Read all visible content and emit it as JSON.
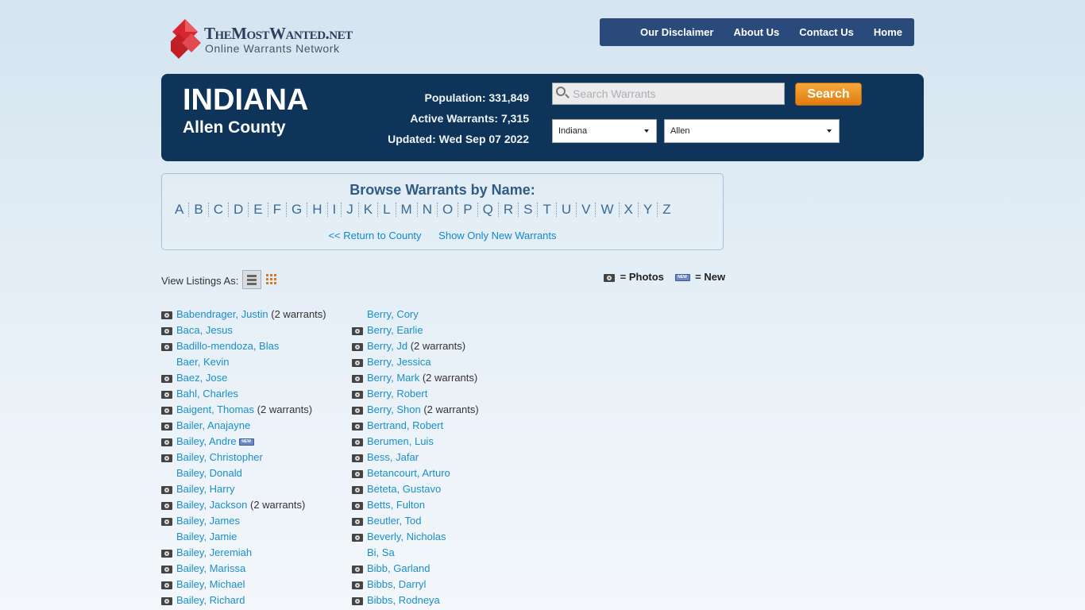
{
  "logo": {
    "title": "TheMostWanted.net",
    "subtitle": "Online Warrants Network"
  },
  "nav": {
    "items": [
      "Our Disclaimer",
      "About Us",
      "Contact Us",
      "Home"
    ]
  },
  "banner": {
    "state": "INDIANA",
    "county": "Allen County",
    "population": "Population: 331,849",
    "active_warrants": "Active Warrants: 7,315",
    "updated": "Updated: Wed Sep 07 2022",
    "search_placeholder": "Search Warrants",
    "search_button": "Search",
    "state_select": "Indiana",
    "county_select": "Allen"
  },
  "browse": {
    "title": "Browse Warrants by Name:",
    "letters": [
      "A",
      "B",
      "C",
      "D",
      "E",
      "F",
      "G",
      "H",
      "I",
      "J",
      "K",
      "L",
      "M",
      "N",
      "O",
      "P",
      "Q",
      "R",
      "S",
      "T",
      "U",
      "V",
      "W",
      "X",
      "Y",
      "Z"
    ],
    "return_link": "<< Return to County",
    "new_link": "Show Only New Warrants"
  },
  "view": {
    "label": "View Listings As:"
  },
  "legend": {
    "photos": "= Photos",
    "new_badge": "NEW",
    "new": "= New"
  },
  "listings": {
    "col1": [
      {
        "name": "Babendrager, Justin",
        "photo": true,
        "count": "(2 warrants)"
      },
      {
        "name": "Baca, Jesus",
        "photo": true,
        "count": ""
      },
      {
        "name": "Badillo-mendoza, Blas",
        "photo": true,
        "count": ""
      },
      {
        "name": "Baer, Kevin",
        "photo": false,
        "count": ""
      },
      {
        "name": "Baez, Jose",
        "photo": true,
        "count": ""
      },
      {
        "name": "Bahl, Charles",
        "photo": true,
        "count": ""
      },
      {
        "name": "Baigent, Thomas",
        "photo": true,
        "count": "(2 warrants)"
      },
      {
        "name": "Bailer, Anajayne",
        "photo": true,
        "count": ""
      },
      {
        "name": "Bailey, Andre",
        "photo": true,
        "count": "",
        "new": true
      },
      {
        "name": "Bailey, Christopher",
        "photo": true,
        "count": ""
      },
      {
        "name": "Bailey, Donald",
        "photo": false,
        "count": ""
      },
      {
        "name": "Bailey, Harry",
        "photo": true,
        "count": ""
      },
      {
        "name": "Bailey, Jackson",
        "photo": true,
        "count": "(2 warrants)"
      },
      {
        "name": "Bailey, James",
        "photo": true,
        "count": ""
      },
      {
        "name": "Bailey, Jamie",
        "photo": false,
        "count": ""
      },
      {
        "name": "Bailey, Jeremiah",
        "photo": true,
        "count": ""
      },
      {
        "name": "Bailey, Marissa",
        "photo": true,
        "count": ""
      },
      {
        "name": "Bailey, Michael",
        "photo": true,
        "count": ""
      },
      {
        "name": "Bailey, Richard",
        "photo": true,
        "count": ""
      }
    ],
    "col2": [
      {
        "name": "Berry, Cory",
        "photo": false,
        "count": ""
      },
      {
        "name": "Berry, Earlie",
        "photo": true,
        "count": ""
      },
      {
        "name": "Berry, Jd",
        "photo": true,
        "count": "(2 warrants)"
      },
      {
        "name": "Berry, Jessica",
        "photo": true,
        "count": ""
      },
      {
        "name": "Berry, Mark",
        "photo": true,
        "count": "(2 warrants)"
      },
      {
        "name": "Berry, Robert",
        "photo": true,
        "count": ""
      },
      {
        "name": "Berry, Shon",
        "photo": true,
        "count": "(2 warrants)"
      },
      {
        "name": "Bertrand, Robert",
        "photo": true,
        "count": ""
      },
      {
        "name": "Berumen, Luis",
        "photo": true,
        "count": ""
      },
      {
        "name": "Bess, Jafar",
        "photo": true,
        "count": ""
      },
      {
        "name": "Betancourt, Arturo",
        "photo": true,
        "count": ""
      },
      {
        "name": "Beteta, Gustavo",
        "photo": true,
        "count": ""
      },
      {
        "name": "Betts, Fulton",
        "photo": true,
        "count": ""
      },
      {
        "name": "Beutler, Tod",
        "photo": true,
        "count": ""
      },
      {
        "name": "Beverly, Nicholas",
        "photo": true,
        "count": ""
      },
      {
        "name": "Bi, Sa",
        "photo": false,
        "count": ""
      },
      {
        "name": "Bibb, Garland",
        "photo": true,
        "count": ""
      },
      {
        "name": "Bibbs, Darryl",
        "photo": true,
        "count": ""
      },
      {
        "name": "Bibbs, Rodneya",
        "photo": true,
        "count": ""
      }
    ]
  }
}
